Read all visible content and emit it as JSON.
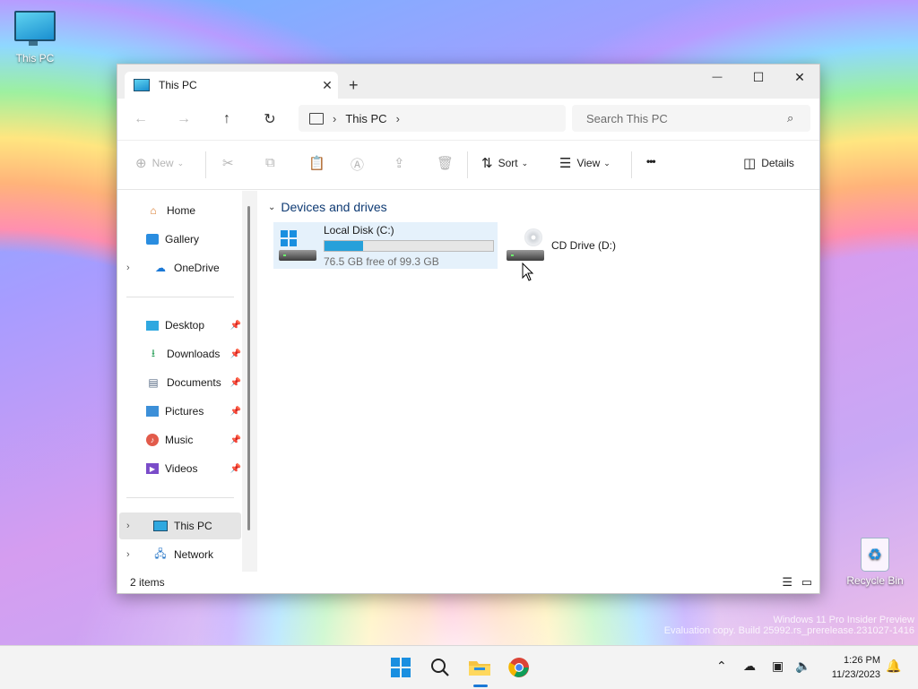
{
  "desktop": {
    "this_pc_label": "This PC",
    "recycle_bin_label": "Recycle Bin",
    "watermark_line1": "Windows 11 Pro Insider Preview",
    "watermark_line2": "Evaluation copy. Build 25992.rs_prerelease.231027-1416"
  },
  "window": {
    "tab_title": "This PC",
    "tab_close": "✕",
    "new_tab": "+",
    "minimize": "—",
    "maximize": "☐",
    "close": "✕"
  },
  "nav": {
    "back": "←",
    "forward": "→",
    "up": "↑",
    "refresh": "↻",
    "breadcrumb": [
      "This PC"
    ],
    "search_placeholder": "Search This PC"
  },
  "commands": {
    "new": "New",
    "sort": "Sort",
    "view": "View",
    "more": "•••",
    "details": "Details"
  },
  "sidebar": {
    "items": [
      {
        "label": "Home",
        "icon": "home-icon"
      },
      {
        "label": "Gallery",
        "icon": "gallery-icon"
      },
      {
        "label": "OneDrive",
        "icon": "onedrive-icon"
      },
      {
        "label": "Desktop",
        "icon": "desktop-icon"
      },
      {
        "label": "Downloads",
        "icon": "downloads-icon"
      },
      {
        "label": "Documents",
        "icon": "documents-icon"
      },
      {
        "label": "Pictures",
        "icon": "pictures-icon"
      },
      {
        "label": "Music",
        "icon": "music-icon"
      },
      {
        "label": "Videos",
        "icon": "videos-icon"
      },
      {
        "label": "This PC",
        "icon": "this-pc-icon"
      },
      {
        "label": "Network",
        "icon": "network-icon"
      }
    ]
  },
  "content": {
    "group_title": "Devices and drives",
    "drives": [
      {
        "name": "Local Disk (C:)",
        "free_text": "76.5 GB free of 99.3 GB",
        "used_fraction": 0.23
      },
      {
        "name": "CD Drive (D:)"
      }
    ]
  },
  "status": {
    "item_count": "2 items"
  },
  "taskbar": {
    "time": "1:26 PM",
    "date": "11/23/2023"
  },
  "colors": {
    "accent": "#26a0da",
    "group_title": "#0e3a73",
    "selection": "#e5f1fb"
  }
}
